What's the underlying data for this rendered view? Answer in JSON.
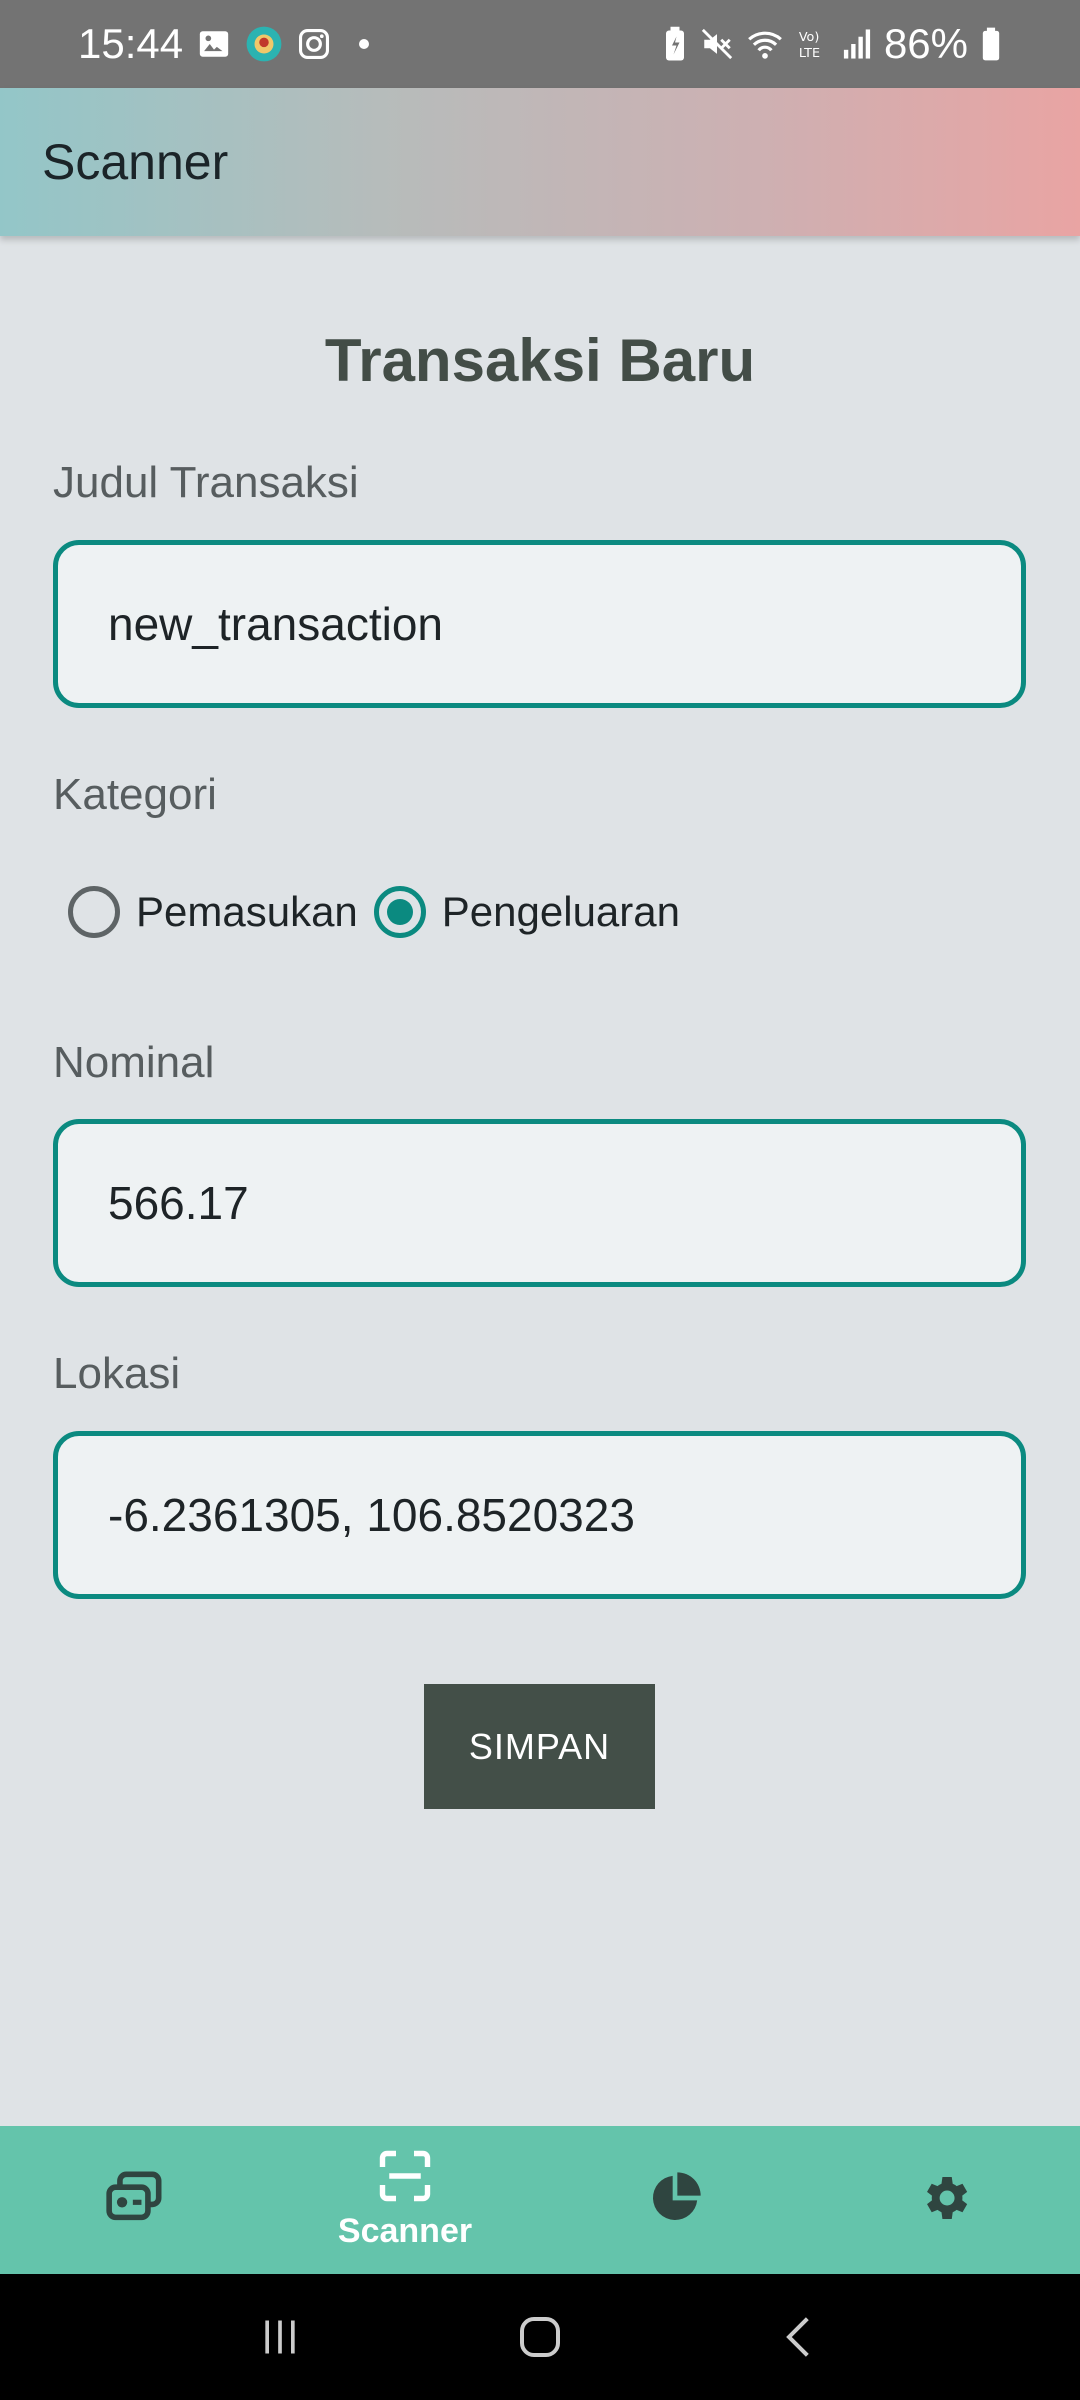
{
  "status_bar": {
    "time": "15:44",
    "battery_percent": "86%",
    "icons_left": [
      "gallery-icon",
      "app-avatar-icon",
      "instagram-icon",
      "notification-dot-icon"
    ],
    "icons_right": [
      "battery-saver-icon",
      "mute-icon",
      "wifi-icon",
      "volte-icon",
      "signal-icon",
      "battery-icon"
    ]
  },
  "app_bar": {
    "title": "Scanner"
  },
  "form": {
    "title": "Transaksi Baru",
    "judul_label": "Judul Transaksi",
    "judul_value": "new_transaction",
    "kategori_label": "Kategori",
    "kategori_options": [
      {
        "label": "Pemasukan",
        "selected": false
      },
      {
        "label": "Pengeluaran",
        "selected": true
      }
    ],
    "nominal_label": "Nominal",
    "nominal_value": "566.17",
    "lokasi_label": "Lokasi",
    "lokasi_value": "-6.2361305, 106.8520323",
    "save_label": "SIMPAN"
  },
  "bottom_nav": {
    "items": [
      {
        "icon": "wallet-icon",
        "label": "",
        "active": false
      },
      {
        "icon": "scanner-icon",
        "label": "Scanner",
        "active": true
      },
      {
        "icon": "pie-chart-icon",
        "label": "",
        "active": false
      },
      {
        "icon": "gear-icon",
        "label": "",
        "active": false
      }
    ]
  },
  "colors": {
    "accent": "#0b8a80",
    "nav_background": "#64c4ab",
    "button": "#434f48"
  }
}
